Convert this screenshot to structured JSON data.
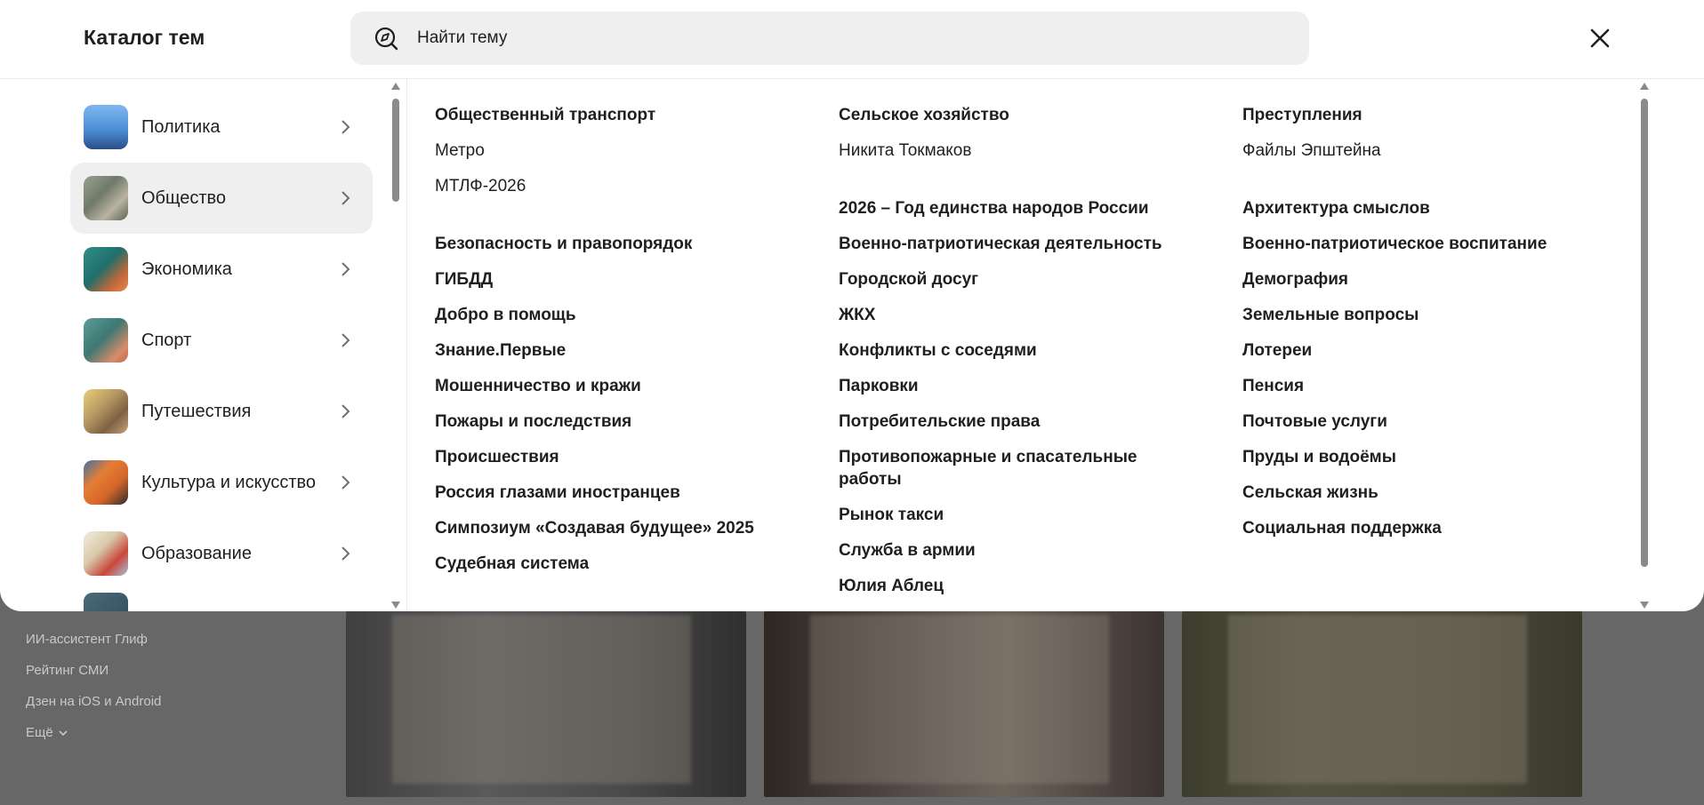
{
  "catalog": {
    "title": "Каталог тем",
    "search_placeholder": "Найти тему",
    "close_icon": "close-icon",
    "search_icon": "compass-search-icon"
  },
  "categories": [
    {
      "label": "Политика",
      "active": false
    },
    {
      "label": "Общество",
      "active": true
    },
    {
      "label": "Экономика",
      "active": false
    },
    {
      "label": "Спорт",
      "active": false
    },
    {
      "label": "Путешествия",
      "active": false
    },
    {
      "label": "Культура и искусство",
      "active": false
    },
    {
      "label": "Образование",
      "active": false
    }
  ],
  "topics": {
    "col1": [
      "Общественный транспорт",
      "Метро",
      "МТЛФ-2026",
      "Безопасность и правопорядок",
      "ГИБДД",
      "Добро в помощь",
      "Знание.Первые",
      "Мошенничество и кражи",
      "Пожары и последствия",
      "Происшествия",
      "Россия глазами иностранцев",
      "Симпозиум «Создавая будущее» 2025",
      "Судебная система"
    ],
    "col2": [
      "Сельское хозяйство",
      "Никита Токмаков",
      "2026 – Год единства народов России",
      "Военно-патриотическая деятельность",
      "Городской досуг",
      "ЖКХ",
      "Конфликты с соседями",
      "Парковки",
      "Потребительские права",
      "Противопожарные и спасательные работы",
      "Рынок такси",
      "Служба в армии",
      "Юлия Аблец"
    ],
    "col3": [
      "Преступления",
      "Файлы Эпштейна",
      "Архитектура смыслов",
      "Военно-патриотическое воспитание",
      "Демография",
      "Земельные вопросы",
      "Лотереи",
      "Пенсия",
      "Почтовые услуги",
      "Пруды и водоёмы",
      "Сельская жизнь",
      "Социальная поддержка"
    ]
  },
  "background": {
    "links": [
      "ИИ-ассистент Глиф",
      "Рейтинг СМИ",
      "Дзен на iOS и Android",
      "Ещё"
    ]
  },
  "colors": {
    "text": "#1f1f1f",
    "panel": "#ffffff",
    "active_item": "#efefef",
    "search_bg": "#efefef",
    "overlay": "#676767"
  }
}
